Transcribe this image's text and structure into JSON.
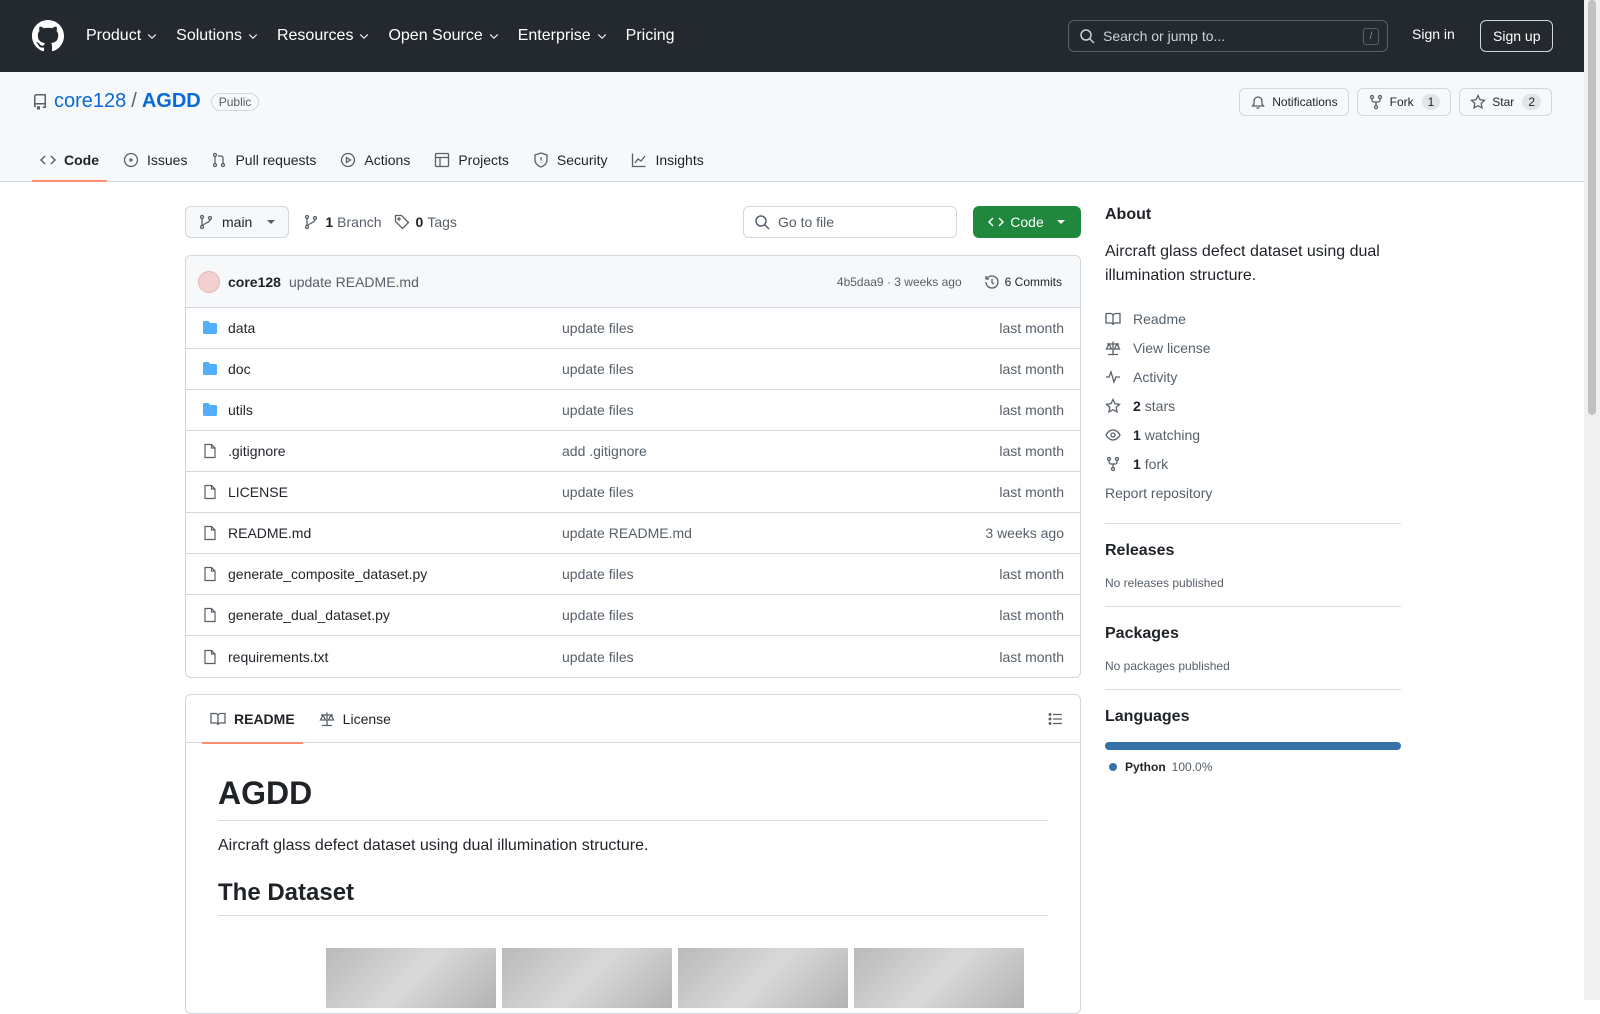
{
  "header": {
    "nav": [
      "Product",
      "Solutions",
      "Resources",
      "Open Source",
      "Enterprise",
      "Pricing"
    ],
    "search_placeholder": "Search or jump to...",
    "search_shortcut": "/",
    "signin": "Sign in",
    "signup": "Sign up"
  },
  "repo": {
    "owner": "core128",
    "separator": "/",
    "name": "AGDD",
    "visibility": "Public",
    "notifications": "Notifications",
    "fork": "Fork",
    "fork_count": "1",
    "star": "Star",
    "star_count": "2"
  },
  "tabs": [
    "Code",
    "Issues",
    "Pull requests",
    "Actions",
    "Projects",
    "Security",
    "Insights"
  ],
  "toolbar": {
    "branch": "main",
    "branches_count": "1",
    "branches_label": "Branch",
    "tags_count": "0",
    "tags_label": "Tags",
    "gofile": "Go to file",
    "code": "Code"
  },
  "commit": {
    "author": "core128",
    "message": "update README.md",
    "hash_time": "4b5daa9 · 3 weeks ago",
    "commits": "6 Commits"
  },
  "files": [
    {
      "name": "data",
      "msg": "update files",
      "date": "last month",
      "type": "dir"
    },
    {
      "name": "doc",
      "msg": "update files",
      "date": "last month",
      "type": "dir"
    },
    {
      "name": "utils",
      "msg": "update files",
      "date": "last month",
      "type": "dir"
    },
    {
      "name": ".gitignore",
      "msg": "add .gitignore",
      "date": "last month",
      "type": "file"
    },
    {
      "name": "LICENSE",
      "msg": "update files",
      "date": "last month",
      "type": "file"
    },
    {
      "name": "README.md",
      "msg": "update README.md",
      "date": "3 weeks ago",
      "type": "file"
    },
    {
      "name": "generate_composite_dataset.py",
      "msg": "update files",
      "date": "last month",
      "type": "file"
    },
    {
      "name": "generate_dual_dataset.py",
      "msg": "update files",
      "date": "last month",
      "type": "file"
    },
    {
      "name": "requirements.txt",
      "msg": "update files",
      "date": "last month",
      "type": "file"
    }
  ],
  "readme": {
    "tab_readme": "README",
    "tab_license": "License",
    "title": "AGDD",
    "description": "Aircraft glass defect dataset using dual illumination structure.",
    "section": "The Dataset"
  },
  "about": {
    "title": "About",
    "description": "Aircraft glass defect dataset using dual illumination structure.",
    "readme": "Readme",
    "license": "View license",
    "activity": "Activity",
    "stars_n": "2",
    "stars": "stars",
    "watching_n": "1",
    "watching": "watching",
    "fork_n": "1",
    "fork": "fork",
    "report": "Report repository"
  },
  "releases": {
    "title": "Releases",
    "text": "No releases published"
  },
  "packages": {
    "title": "Packages",
    "text": "No packages published"
  },
  "languages": {
    "title": "Languages",
    "name": "Python",
    "percent": "100.0%",
    "color": "#3572a5"
  }
}
